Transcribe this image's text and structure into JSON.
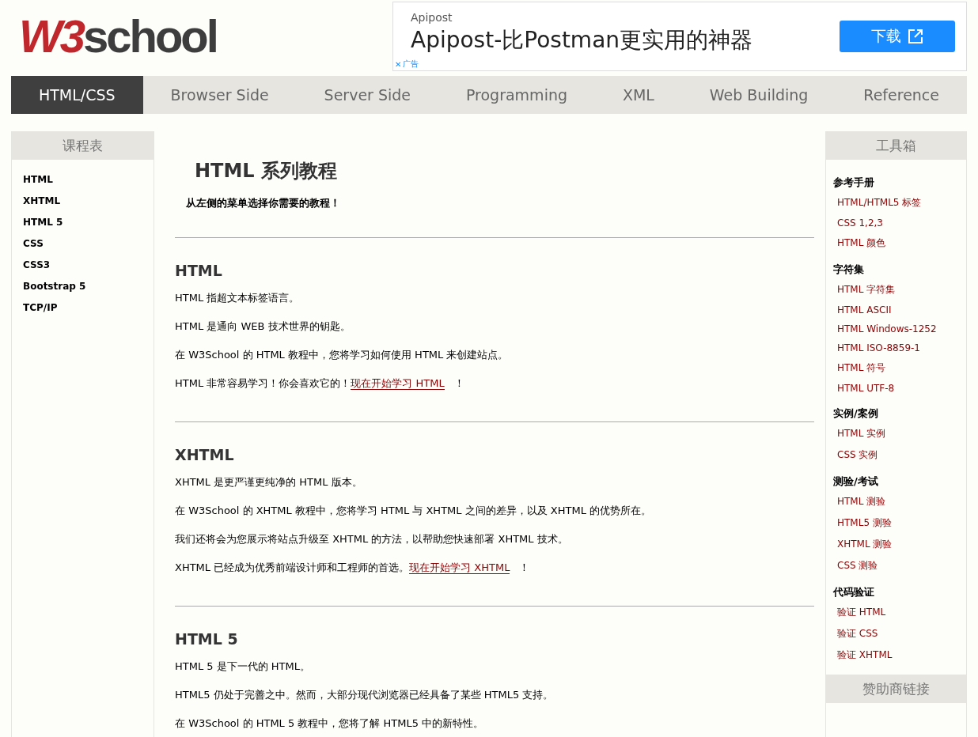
{
  "logo": {
    "brand": "W3",
    "rest": "school"
  },
  "ad": {
    "advertiser": "Apipost",
    "headline": "Apipost-比Postman更实用的神器",
    "button": "下载",
    "badge_close": "✕",
    "badge": "广告"
  },
  "nav": [
    {
      "label": "HTML/CSS",
      "selected": true
    },
    {
      "label": "Browser Side",
      "selected": false
    },
    {
      "label": "Server Side",
      "selected": false
    },
    {
      "label": "Programming",
      "selected": false
    },
    {
      "label": "XML",
      "selected": false
    },
    {
      "label": "Web Building",
      "selected": false
    },
    {
      "label": "Reference",
      "selected": false
    }
  ],
  "left_sidebar": {
    "title": "课程表",
    "items": [
      "HTML",
      "XHTML",
      "HTML 5",
      "CSS",
      "CSS3",
      "Bootstrap 5",
      "TCP/IP"
    ]
  },
  "main": {
    "title": "HTML 系列教程",
    "intro": "从左侧的菜单选择你需要的教程！",
    "sections": [
      {
        "heading": "HTML",
        "paragraphs": [
          {
            "text": "HTML 指超文本标签语言。"
          },
          {
            "text": "HTML 是通向 WEB 技术世界的钥匙。"
          },
          {
            "text": "在 W3School 的 HTML 教程中，您将学习如何使用 HTML 来创建站点。"
          },
          {
            "text": "HTML 非常容易学习！你会喜欢它的！",
            "link": "现在开始学习 HTML",
            "after": "！"
          }
        ]
      },
      {
        "heading": "XHTML",
        "paragraphs": [
          {
            "text": "XHTML 是更严谨更纯净的 HTML 版本。"
          },
          {
            "text": "在 W3School 的 XHTML 教程中，您将学习 HTML 与 XHTML 之间的差异，以及 XHTML 的优势所在。"
          },
          {
            "text": "我们还将会为您展示将站点升级至 XHTML 的方法，以帮助您快速部署 XHTML 技术。"
          },
          {
            "text": "XHTML 已经成为优秀前端设计师和工程师的首选。",
            "link": "现在开始学习 XHTML",
            "after": "！"
          }
        ]
      },
      {
        "heading": "HTML 5",
        "paragraphs": [
          {
            "text": "HTML 5 是下一代的 HTML。"
          },
          {
            "text": "HTML5 仍处于完善之中。然而，大部分现代浏览器已经具备了某些 HTML5 支持。"
          },
          {
            "text": "在 W3School 的 HTML 5 教程中，您将了解 HTML5 中的新特性。"
          }
        ]
      }
    ]
  },
  "right_sidebar": {
    "title": "工具箱",
    "groups": [
      {
        "heading": "参考手册",
        "links": [
          "HTML/HTML5 标签",
          "CSS 1,2,3",
          "HTML 颜色"
        ]
      },
      {
        "heading": "字符集",
        "links": [
          "HTML 字符集",
          "HTML ASCII",
          "HTML Windows-1252",
          "HTML ISO-8859-1",
          "HTML 符号",
          "HTML UTF-8"
        ]
      },
      {
        "heading": "实例/案例",
        "links": [
          "HTML 实例",
          "CSS 实例"
        ]
      },
      {
        "heading": "测验/考试",
        "links": [
          "HTML 测验",
          "HTML5 测验",
          "XHTML 测验",
          "CSS 测验"
        ]
      },
      {
        "heading": "代码验证",
        "links": [
          "验证 HTML",
          "验证 CSS",
          "验证 XHTML"
        ]
      }
    ],
    "sponsor_title": "赞助商链接"
  }
}
